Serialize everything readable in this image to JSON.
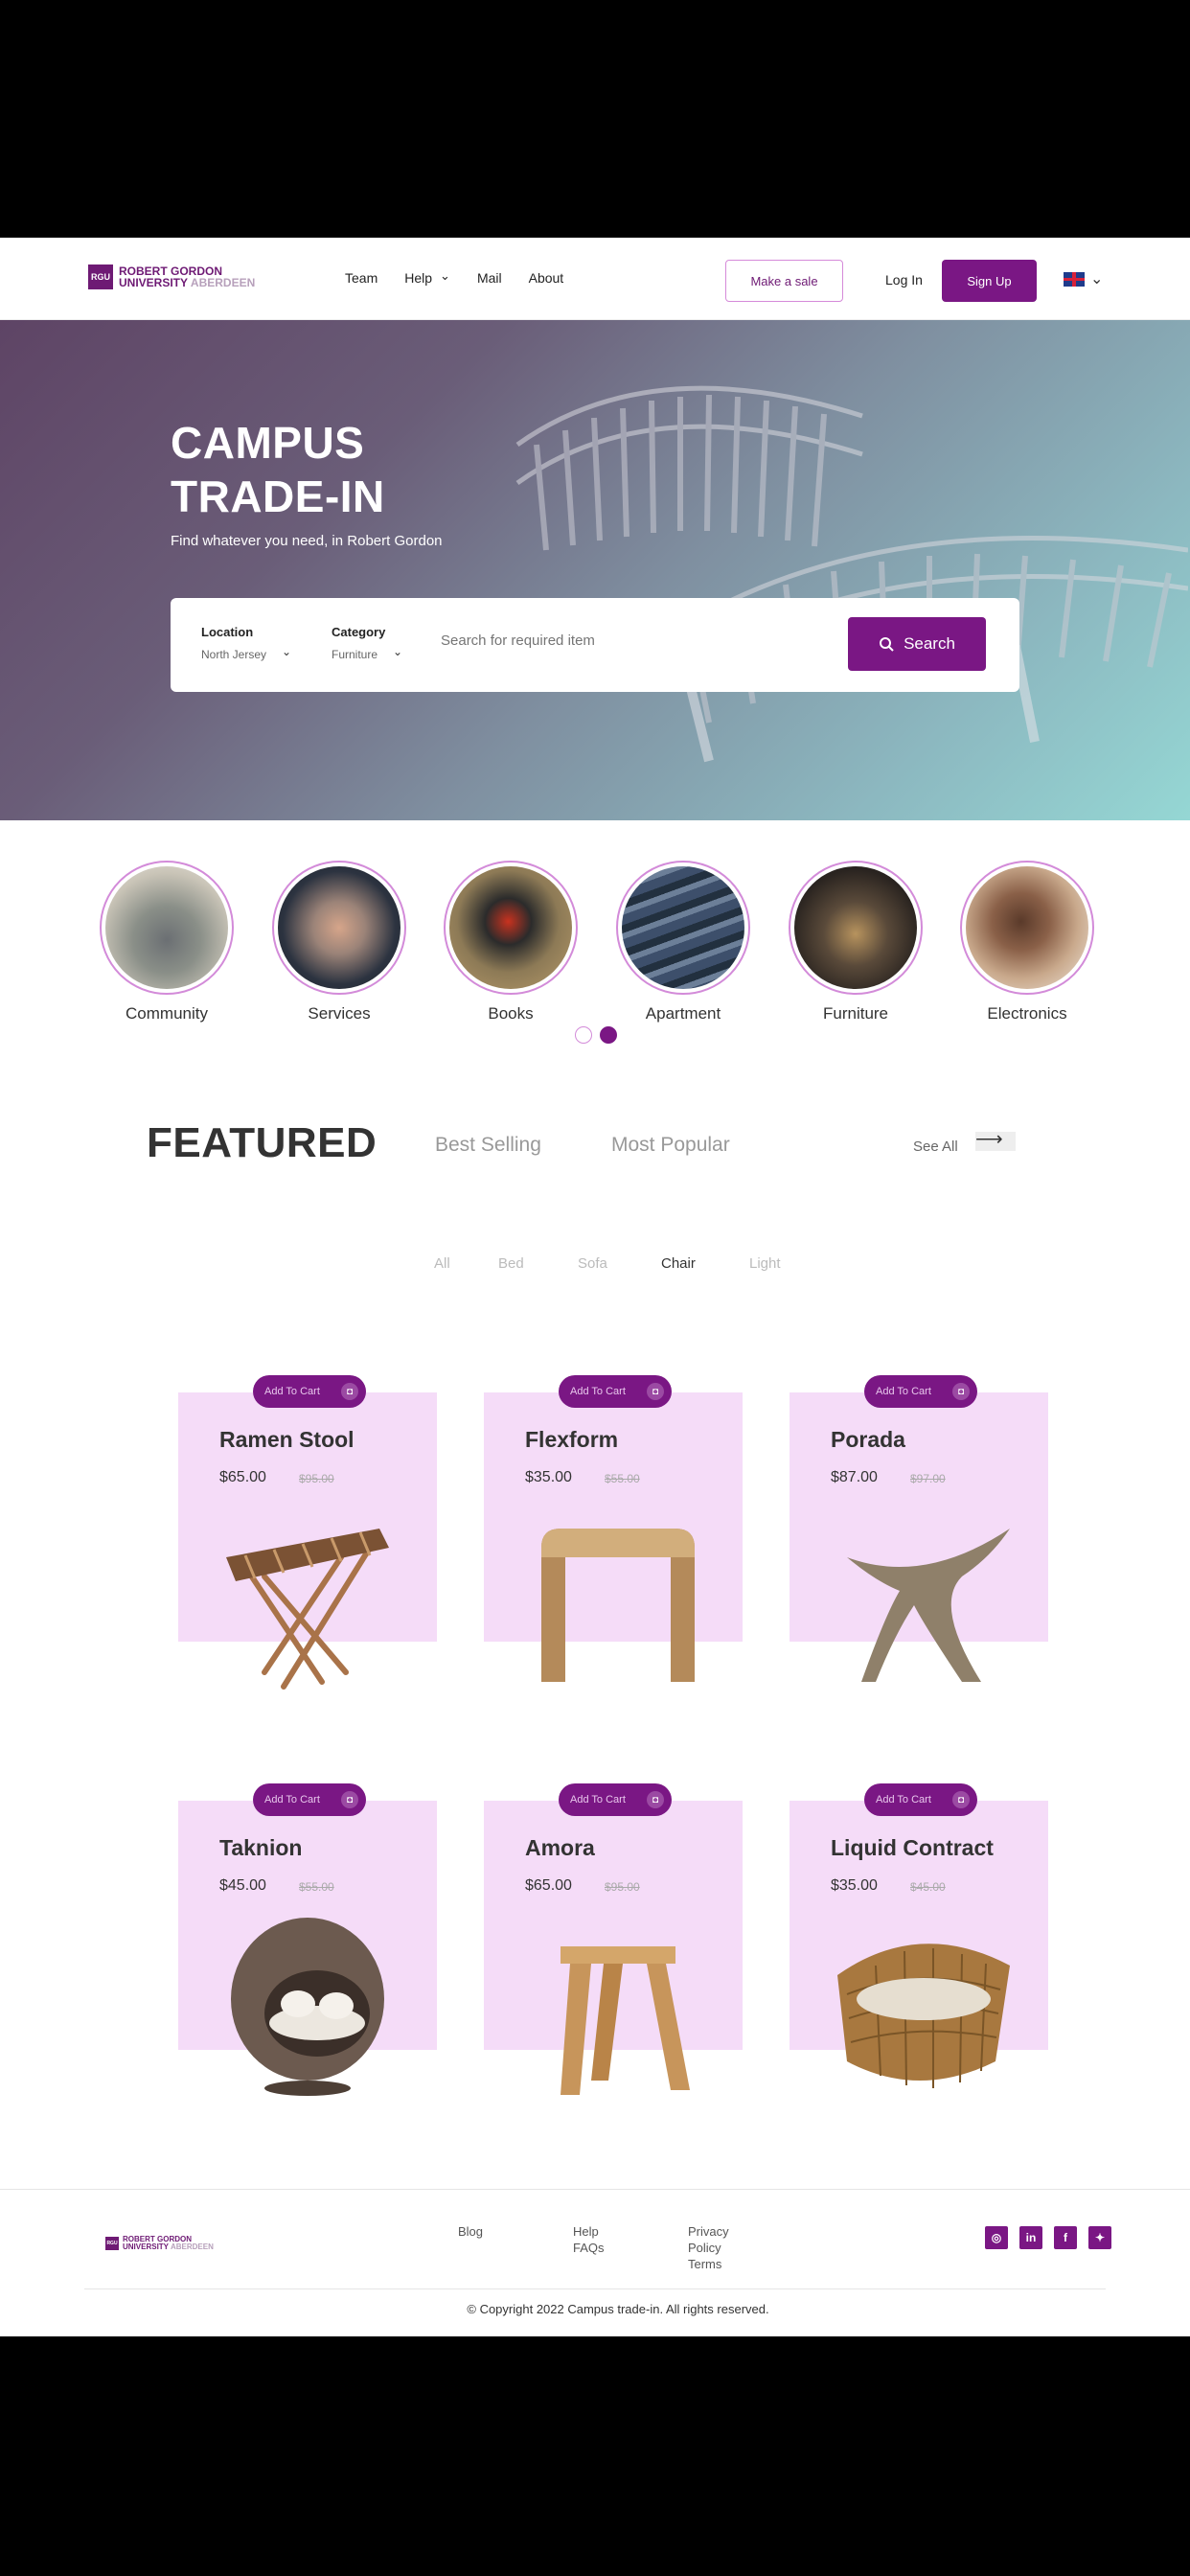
{
  "brand": {
    "line1": "ROBERT GORDON",
    "line2a": "UNIVERSITY",
    "line2b": "ABERDEEN",
    "mark": "RGU"
  },
  "nav": {
    "links": [
      "Team",
      "Help",
      "Mail",
      "About"
    ],
    "make_sale": "Make a sale",
    "login": "Log In",
    "signup": "Sign Up",
    "language_icon": "uk-flag-icon"
  },
  "hero": {
    "title_line1": "CAMPUS",
    "title_line2": "TRADE-IN",
    "subtitle": "Find whatever you need, in Robert Gordon",
    "search": {
      "location_label": "Location",
      "location_value": "North Jersey",
      "category_label": "Category",
      "category_value": "Furniture",
      "placeholder": "Search for required item",
      "button": "Search"
    }
  },
  "categories": [
    "Community",
    "Services",
    "Books",
    "Apartment",
    "Furniture",
    "Electronics"
  ],
  "featured": {
    "title": "FEATURED",
    "tabs": [
      "Best Selling",
      "Most Popular"
    ],
    "see_all": "See All",
    "filters": [
      "All",
      "Bed",
      "Sofa",
      "Chair",
      "Light"
    ],
    "active_filter": "Chair"
  },
  "products": [
    {
      "name": "Ramen Stool",
      "price": "$65.00",
      "old_price": "$95.00",
      "cart": "Add To Cart"
    },
    {
      "name": "Flexform",
      "price": "$35.00",
      "old_price": "$55.00",
      "cart": "Add To Cart"
    },
    {
      "name": "Porada",
      "price": "$87.00",
      "old_price": "$97.00",
      "cart": "Add To Cart"
    },
    {
      "name": "Taknion",
      "price": "$45.00",
      "old_price": "$55.00",
      "cart": "Add To Cart"
    },
    {
      "name": "Amora",
      "price": "$65.00",
      "old_price": "$95.00",
      "cart": "Add To Cart"
    },
    {
      "name": "Liquid Contract",
      "price": "$35.00",
      "old_price": "$45.00",
      "cart": "Add To Cart"
    }
  ],
  "footer": {
    "col1": [
      "Blog"
    ],
    "col2": [
      "Help",
      "FAQs"
    ],
    "col3": [
      "Privacy",
      "Policy",
      "Terms"
    ],
    "socials": [
      "instagram-icon",
      "linkedin-icon",
      "facebook-icon",
      "twitter-icon"
    ],
    "copyright": "© Copyright 2022 Campus trade-in. All rights reserved."
  },
  "colors": {
    "primary": "#7a1784",
    "card_bg": "#f5dcf8",
    "accent_border": "#d38bd9"
  }
}
